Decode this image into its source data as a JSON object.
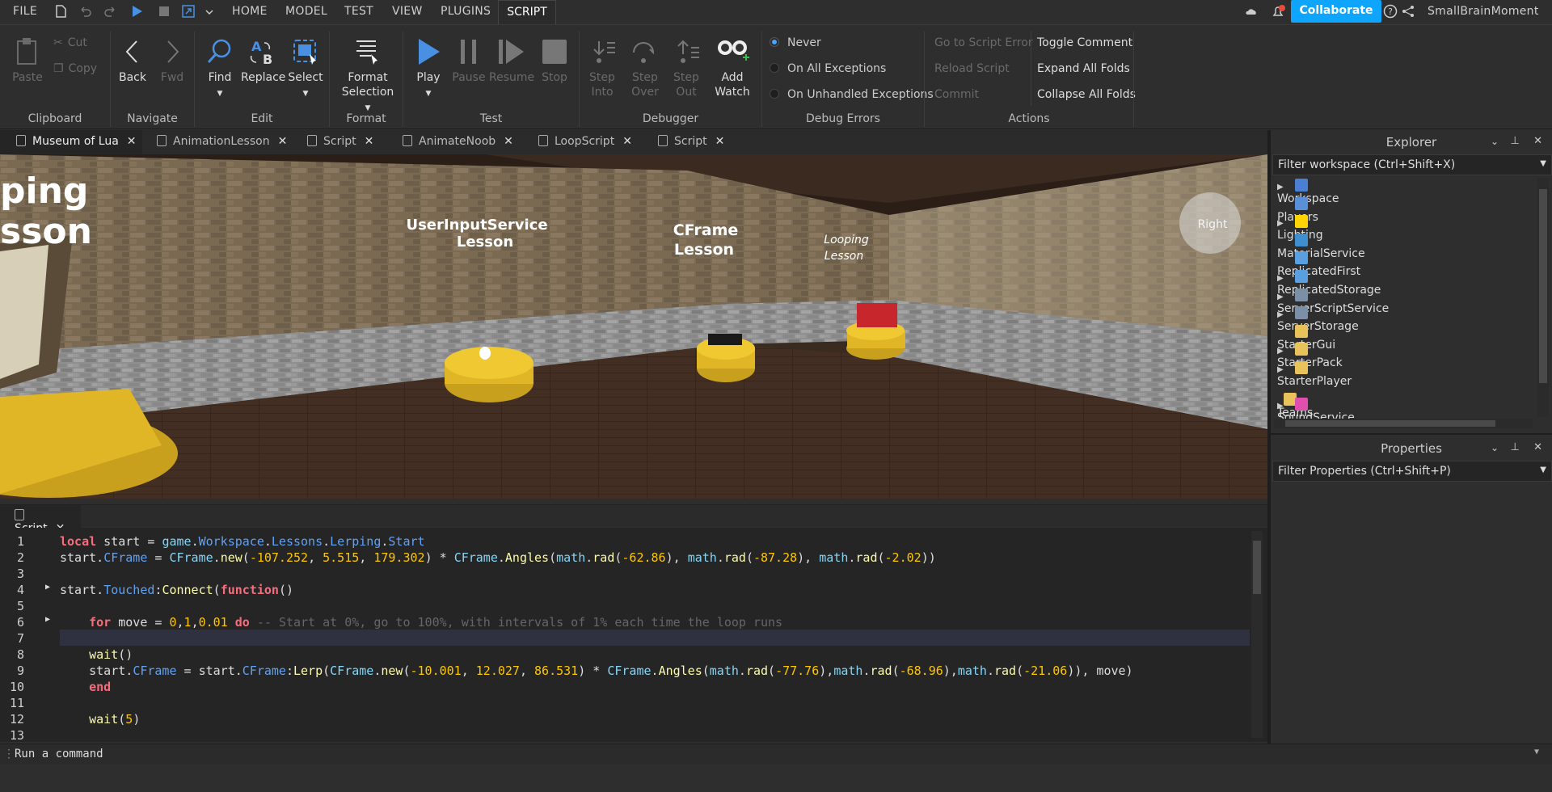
{
  "menubar": {
    "items": [
      "FILE",
      "HOME",
      "MODEL",
      "TEST",
      "VIEW",
      "PLUGINS",
      "SCRIPT"
    ],
    "active": "SCRIPT",
    "collaborate": "Collaborate",
    "username": "SmallBrainMoment"
  },
  "ribbon": {
    "clipboard": {
      "paste": "Paste",
      "cut": "Cut",
      "copy": "Copy",
      "group": "Clipboard"
    },
    "navigate": {
      "back": "Back",
      "fwd": "Fwd",
      "group": "Navigate"
    },
    "edit": {
      "find": "Find",
      "replace": "Replace",
      "select": "Select",
      "group": "Edit"
    },
    "format": {
      "format_selection": "Format Selection",
      "group": "Format"
    },
    "test": {
      "play": "Play",
      "pause": "Pause",
      "resume": "Resume",
      "stop": "Stop",
      "group": "Test"
    },
    "debugger": {
      "step_into": "Step Into",
      "step_over": "Step Over",
      "step_out": "Step Out",
      "add_watch": "Add Watch",
      "group": "Debugger"
    },
    "debug_errors": {
      "never": "Never",
      "on_all": "On All Exceptions",
      "on_unhandled": "On Unhandled Exceptions",
      "group": "Debug Errors",
      "selected": "Never"
    },
    "actions": {
      "go_to_error": "Go to Script Error",
      "reload": "Reload Script",
      "commit": "Commit",
      "toggle_comment": "Toggle Comment",
      "expand": "Expand All Folds",
      "collapse": "Collapse All Folds",
      "group": "Actions"
    }
  },
  "doc_tabs": [
    "Museum of Lua",
    "AnimationLesson",
    "Script",
    "AnimateNoob",
    "LoopScript",
    "Script"
  ],
  "viewport": {
    "signs": [
      "UserInputService\nLesson",
      "CFrame\nLesson",
      "Looping\nLesson"
    ],
    "left_sign_top": "ping",
    "left_sign_bottom": "sson",
    "orientation_label": "Right"
  },
  "script_tab": {
    "title": "Script"
  },
  "editor": {
    "line_numbers": [
      "1",
      "2",
      "3",
      "4",
      "5",
      "6",
      "7",
      "8",
      "9",
      "10",
      "11",
      "12",
      "13"
    ]
  },
  "command_bar": {
    "placeholder": "Run a command"
  },
  "explorer": {
    "title": "Explorer",
    "filter": "Filter workspace (Ctrl+Shift+X)",
    "items": [
      {
        "name": "Workspace",
        "expandable": true,
        "color": "#4a7fd6"
      },
      {
        "name": "Players",
        "expandable": false,
        "color": "#5b8fd8"
      },
      {
        "name": "Lighting",
        "expandable": true,
        "color": "#ffd400"
      },
      {
        "name": "MaterialService",
        "expandable": false,
        "color": "#3e8ed0"
      },
      {
        "name": "ReplicatedFirst",
        "expandable": false,
        "color": "#5aa0e0"
      },
      {
        "name": "ReplicatedStorage",
        "expandable": true,
        "color": "#5aa0e0"
      },
      {
        "name": "ServerScriptService",
        "expandable": true,
        "color": "#7b8fa6"
      },
      {
        "name": "ServerStorage",
        "expandable": true,
        "color": "#7b8fa6"
      },
      {
        "name": "StarterGui",
        "expandable": false,
        "color": "#e8c25a"
      },
      {
        "name": "StarterPack",
        "expandable": true,
        "color": "#e8c25a"
      },
      {
        "name": "StarterPlayer",
        "expandable": true,
        "color": "#e8c25a"
      },
      {
        "name": "Teams",
        "expandable": false,
        "color": "#e8c25a"
      },
      {
        "name": "SoundService",
        "expandable": true,
        "color": "#e04fb0"
      }
    ]
  },
  "properties": {
    "title": "Properties",
    "filter": "Filter Properties (Ctrl+Shift+P)"
  },
  "colors": {
    "accent": "#0ea5ff",
    "play": "#4a90e2"
  }
}
